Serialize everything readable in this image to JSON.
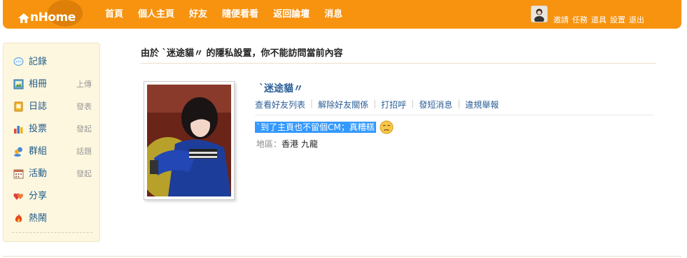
{
  "header": {
    "logo_text": "nHome",
    "nav": [
      "首頁",
      "個人主頁",
      "好友",
      "隨便看看",
      "返回論壇",
      "消息"
    ],
    "user_links": [
      "邀請",
      "任務",
      "道具",
      "設置",
      "退出"
    ]
  },
  "sidebar": {
    "items": [
      {
        "label": "記錄",
        "sub": "",
        "icon": "chat-bubble-icon"
      },
      {
        "label": "相冊",
        "sub": "上傳",
        "icon": "photo-album-icon"
      },
      {
        "label": "日誌",
        "sub": "發表",
        "icon": "diary-icon"
      },
      {
        "label": "投票",
        "sub": "發起",
        "icon": "bar-chart-icon"
      },
      {
        "label": "群組",
        "sub": "話題",
        "icon": "group-icon"
      },
      {
        "label": "活動",
        "sub": "發起",
        "icon": "calendar-icon"
      },
      {
        "label": "分享",
        "sub": "",
        "icon": "hearts-icon"
      },
      {
        "label": "熱鬧",
        "sub": "",
        "icon": "fire-icon"
      }
    ]
  },
  "main": {
    "notice": "由於 `迷途貓〃 的隱私設置，你不能訪問當前內容",
    "profile": {
      "name": "`迷途貓〃",
      "actions": [
        "查看好友列表",
        "解除好友關係",
        "打招呼",
        "發短消息",
        "違規舉報"
      ],
      "status": "`到了主頁也不留個CM；真糟糕",
      "region_label": "地區：",
      "region_value": "香港 九龍"
    }
  },
  "colors": {
    "header_bg": "#f7930f",
    "sidebar_bg": "#fdf7df",
    "link": "#2c5e97",
    "selection": "#3399ff"
  }
}
